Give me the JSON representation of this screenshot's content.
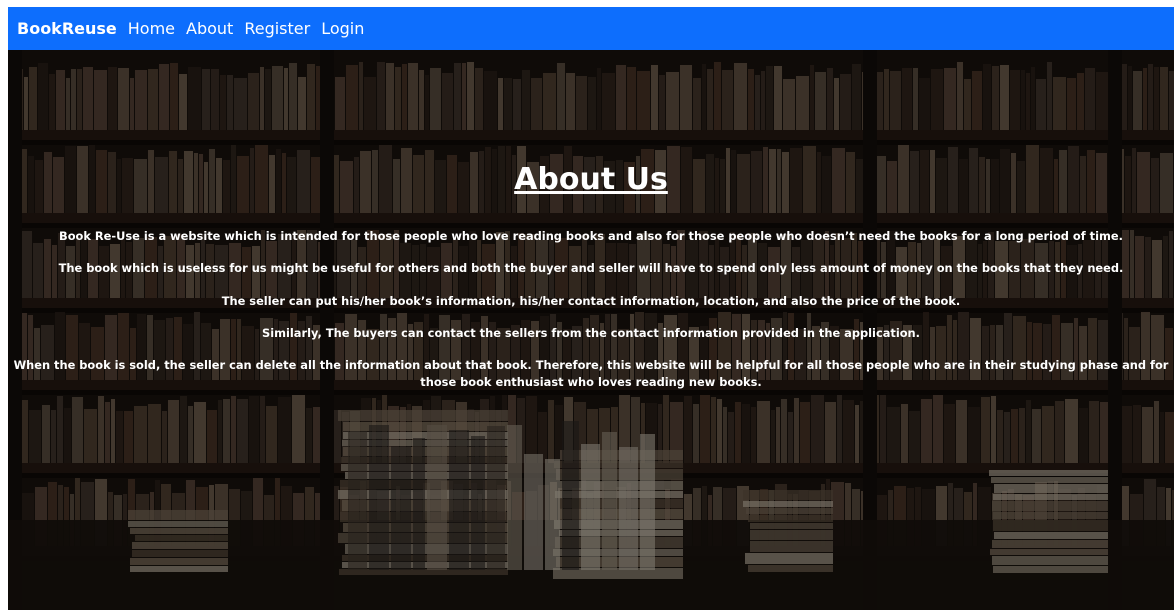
{
  "navbar": {
    "brand": "BookReuse",
    "links": [
      "Home",
      "About",
      "Register",
      "Login"
    ]
  },
  "main": {
    "title": "About Us",
    "paragraphs": [
      "Book Re-Use is a website which is intended for those people who love reading books and also for those people who doesn’t need the books for a long period of time.",
      "The book which is useless for us might be useful for others and both the buyer and seller will have to spend only less amount of money on the books that they need.",
      "The seller can put his/her book’s information, his/her contact information, location, and also the price of the book.",
      "Similarly, The buyers can contact the sellers from the contact information provided in the application.",
      "When the book is sold, the seller can delete all the information about that book. Therefore, this website will be helpful for all those people who are in their studying phase and for those book enthusiast who loves reading new books."
    ]
  },
  "colors": {
    "navbar": "#0d6efd",
    "text": "#ffffff",
    "background": "#1a130e"
  },
  "icons": {
    "background": "bookshelf-background-image"
  }
}
